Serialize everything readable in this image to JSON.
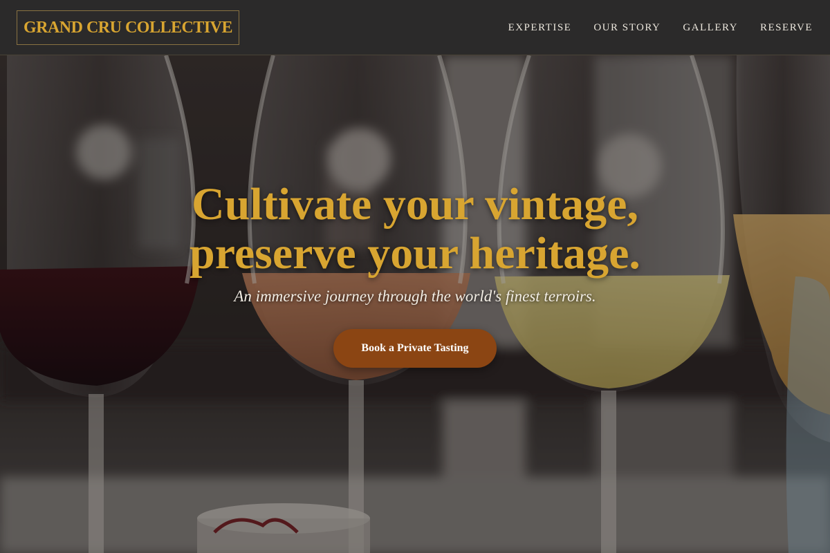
{
  "brand": {
    "name": "GRAND CRU COLLECTIVE"
  },
  "nav": {
    "items": [
      {
        "label": "EXPERTISE"
      },
      {
        "label": "OUR STORY"
      },
      {
        "label": "GALLERY"
      },
      {
        "label": "RESERVE"
      }
    ]
  },
  "hero": {
    "title_line1": "Cultivate your vintage,",
    "title_line2": "preserve your heritage.",
    "subtitle": "An immersive journey through the world's finest terroirs.",
    "cta_label": "Book a Private Tasting",
    "background_image": "photo of red, rosé, white and sparkling wine glasses on a bar"
  },
  "colors": {
    "accent_gold": "#d8a531",
    "cta_brown": "#8b4513",
    "header_bg": "#2b2a2a",
    "nav_text": "#ece7dd"
  }
}
